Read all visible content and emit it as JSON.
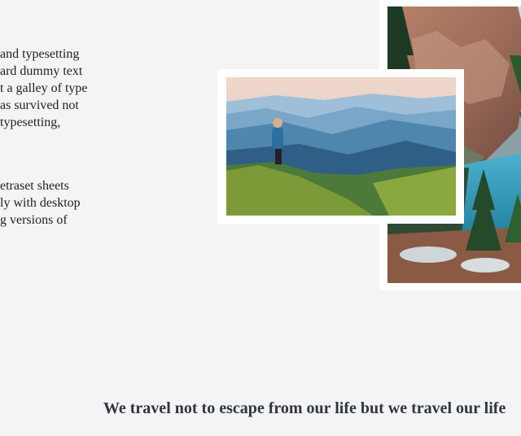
{
  "intro": {
    "paragraph1": [
      "and typesetting",
      "ard dummy text",
      "t a galley of type",
      "as survived not",
      "typesetting,"
    ],
    "paragraph2": [
      "etraset sheets",
      "ly with desktop",
      "g versions of"
    ]
  },
  "gallery": {
    "photo_left_desc": "hiker-on-mountain-ridge",
    "photo_right_desc": "alpine-lake-with-cliffs"
  },
  "quote": {
    "text": "We travel not to escape from our life but we travel our life"
  },
  "colors": {
    "background": "#f4f4f4",
    "quote": "#2f3540"
  }
}
